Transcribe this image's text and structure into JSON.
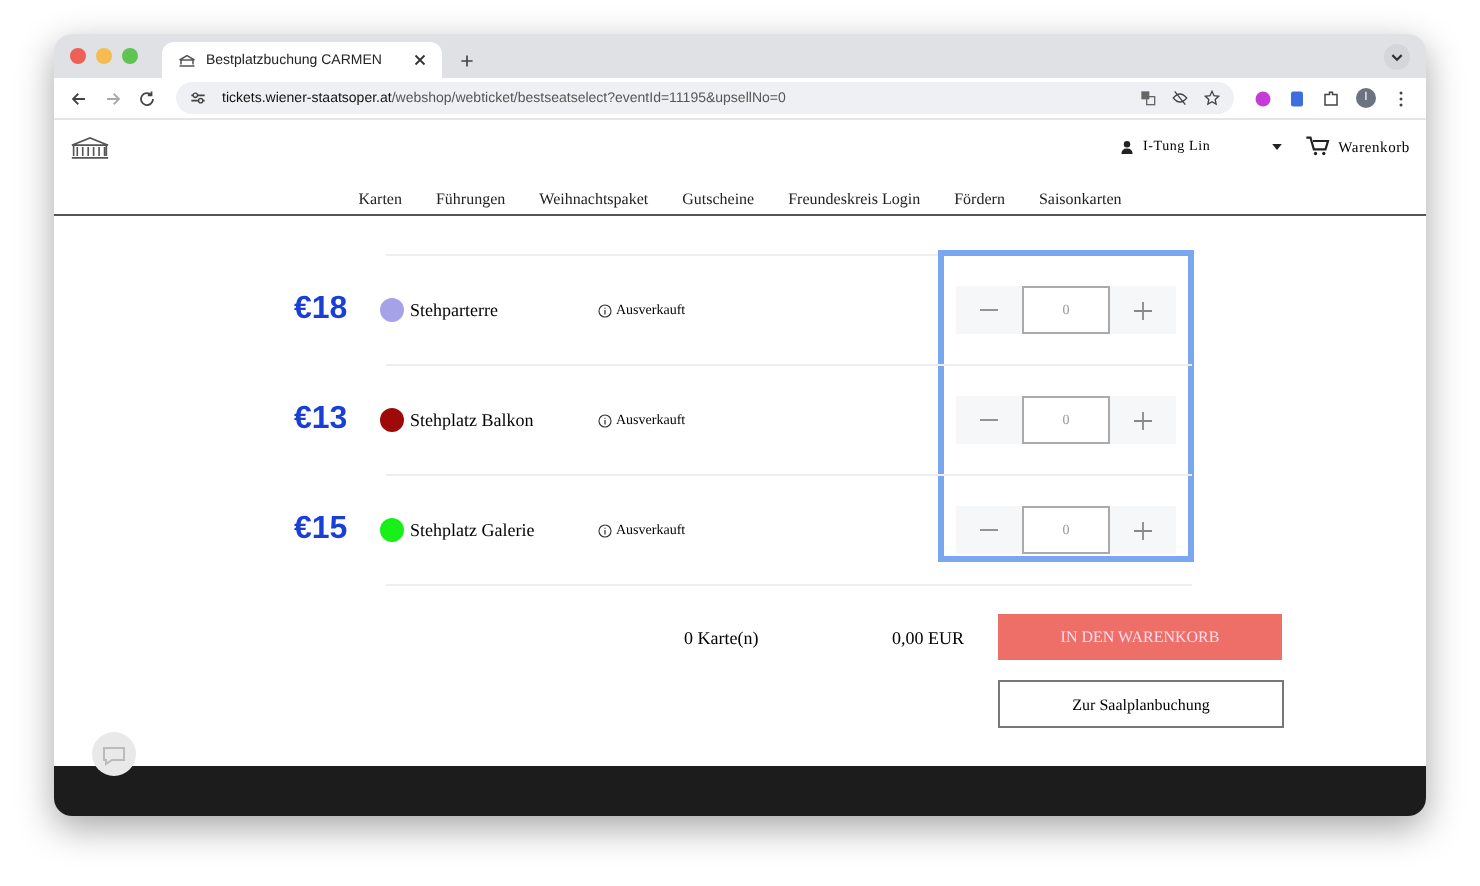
{
  "browser": {
    "tab_title": "Bestplatzbuchung CARMEN",
    "url_host": "tickets.wiener-staatsoper.at",
    "url_path": "/webshop/webticket/bestseatselect?eventId=11195&upsellNo=0",
    "profile_initial": "I"
  },
  "header": {
    "user": "I-Tung Lin",
    "cart": "Warenkorb"
  },
  "nav": [
    "Karten",
    "Führungen",
    "Weihnachtspaket",
    "Gutscheine",
    "Freundeskreis Login",
    "Fördern",
    "Saisonkarten"
  ],
  "tickets": {
    "highlighted": true,
    "rows": [
      {
        "price": "€18",
        "name": "Stehparterre",
        "color": "#a5a2e8",
        "status": "Ausverkauft",
        "quantity": "0"
      },
      {
        "price": "€13",
        "name": "Stehplatz Balkon",
        "color": "#9e0a0a",
        "status": "Ausverkauft",
        "quantity": "0"
      },
      {
        "price": "€15",
        "name": "Stehplatz Galerie",
        "color": "#19f019",
        "status": "Ausverkauft",
        "quantity": "0"
      }
    ]
  },
  "summary": {
    "count": "0 Karte(n)",
    "total": "0,00 EUR",
    "add_button": "IN DEN WARENKORB",
    "seatplan_button": "Zur Saalplanbuchung"
  }
}
